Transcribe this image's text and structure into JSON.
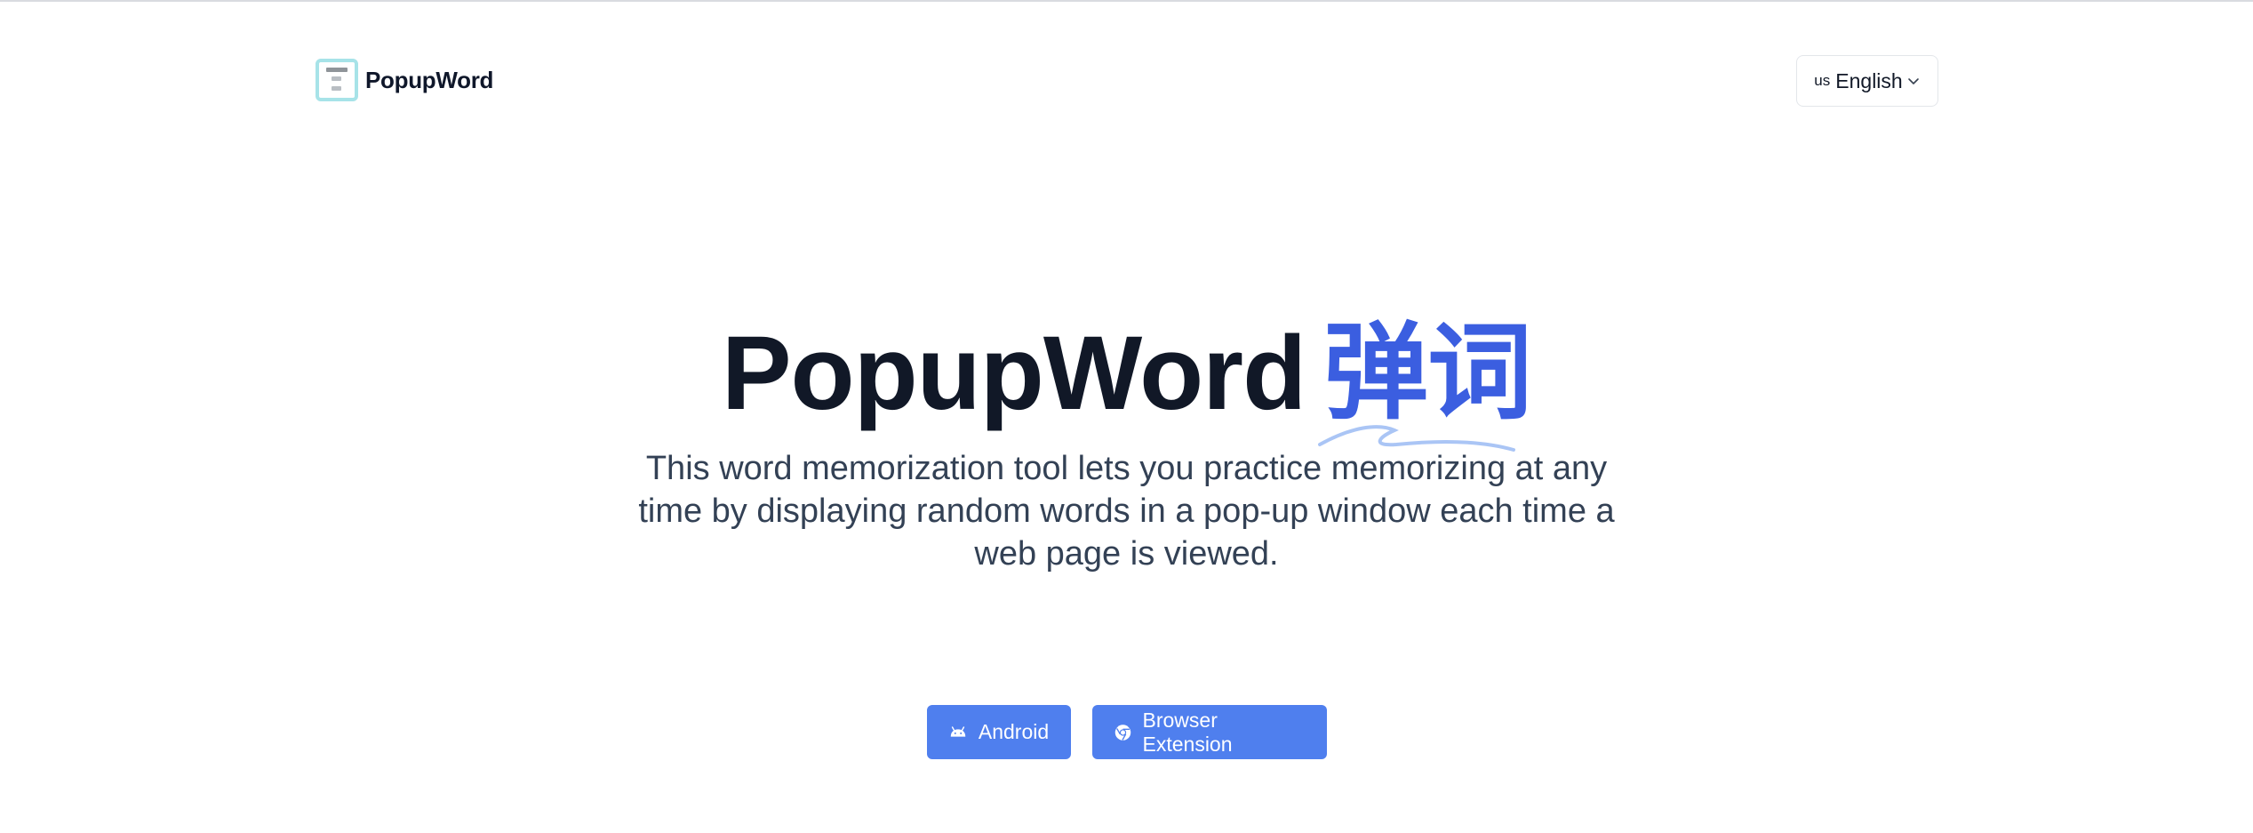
{
  "header": {
    "logo_text": "PopupWord",
    "language": {
      "flag_text": "us",
      "label": "English"
    }
  },
  "hero": {
    "title_main": "PopupWord",
    "title_accent": "弹词",
    "subtitle": "This word memorization tool lets you practice memorizing at any time by displaying random words in a pop-up window each time a web page is viewed."
  },
  "actions": {
    "android_label": "Android",
    "extension_label": "Browser Extension"
  },
  "colors": {
    "accent": "#3b5ee0",
    "button": "#4f7fee",
    "logo_border": "#a7e3e8",
    "title": "#111827",
    "subtitle": "#334155"
  },
  "icons": {
    "logo": "popupword-logo-icon",
    "chevron": "chevron-down-icon",
    "android": "android-icon",
    "chrome": "chrome-icon"
  }
}
